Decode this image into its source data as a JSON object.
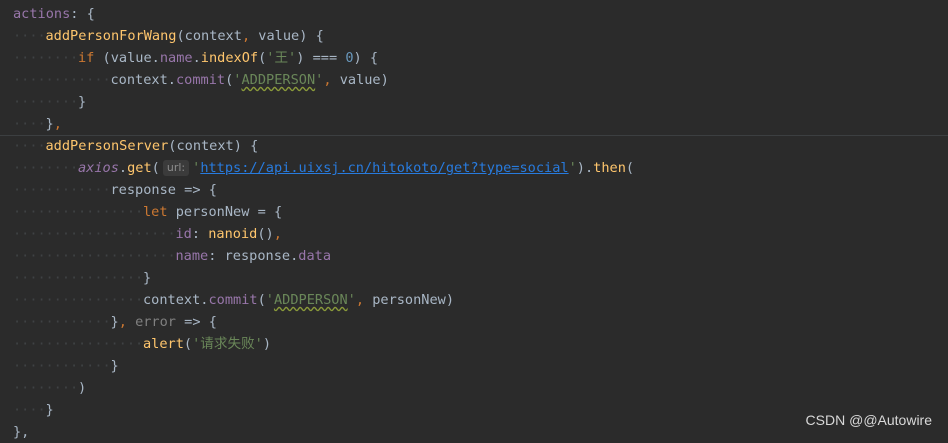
{
  "editor": {
    "lines": [
      {
        "indent": 0,
        "tokens": [
          {
            "t": "actions",
            "c": "prop"
          },
          {
            "t": ": {",
            "c": "plain"
          }
        ]
      },
      {
        "indent": 1,
        "tokens": [
          {
            "t": "addPersonForWang",
            "c": "fn"
          },
          {
            "t": "(context",
            "c": "plain"
          },
          {
            "t": ",",
            "c": "kw"
          },
          {
            "t": " value) {",
            "c": "plain"
          }
        ]
      },
      {
        "indent": 2,
        "tokens": [
          {
            "t": "if",
            "c": "kw"
          },
          {
            "t": " (value.",
            "c": "plain"
          },
          {
            "t": "name",
            "c": "prop"
          },
          {
            "t": ".",
            "c": "plain"
          },
          {
            "t": "indexOf",
            "c": "fn"
          },
          {
            "t": "(",
            "c": "plain"
          },
          {
            "t": "'王'",
            "c": "str"
          },
          {
            "t": ") === ",
            "c": "plain"
          },
          {
            "t": "0",
            "c": "num"
          },
          {
            "t": ") {",
            "c": "plain"
          }
        ]
      },
      {
        "indent": 3,
        "tokens": [
          {
            "t": "context.",
            "c": "plain"
          },
          {
            "t": "commit",
            "c": "prop"
          },
          {
            "t": "(",
            "c": "plain"
          },
          {
            "t": "'",
            "c": "str"
          },
          {
            "t": "ADDPERSON",
            "c": "str squig-str"
          },
          {
            "t": "'",
            "c": "str"
          },
          {
            "t": ",",
            "c": "kw"
          },
          {
            "t": " value)",
            "c": "plain"
          }
        ]
      },
      {
        "indent": 2,
        "tokens": [
          {
            "t": "}",
            "c": "plain"
          }
        ]
      },
      {
        "indent": 1,
        "tokens": [
          {
            "t": "}",
            "c": "plain"
          },
          {
            "t": ",",
            "c": "kw"
          }
        ]
      },
      {
        "indent": 1,
        "tokens": [
          {
            "t": "addPersonServer",
            "c": "fn"
          },
          {
            "t": "(context) {",
            "c": "plain"
          }
        ]
      },
      {
        "indent": 2,
        "tokens": [
          {
            "t": "axios",
            "c": "ital"
          },
          {
            "t": ".",
            "c": "plain"
          },
          {
            "t": "get",
            "c": "fn"
          },
          {
            "t": "(",
            "c": "plain"
          },
          {
            "t": "url:",
            "c": "hint"
          },
          {
            "t": "'",
            "c": "str"
          },
          {
            "t": "https://api.uixsj.cn/hitokoto/get?type=social",
            "c": "url"
          },
          {
            "t": "'",
            "c": "str"
          },
          {
            "t": ").",
            "c": "plain"
          },
          {
            "t": "then",
            "c": "fn"
          },
          {
            "t": "(",
            "c": "plain"
          }
        ]
      },
      {
        "indent": 3,
        "tokens": [
          {
            "t": "response => {",
            "c": "plain"
          }
        ]
      },
      {
        "indent": 4,
        "tokens": [
          {
            "t": "let",
            "c": "kw"
          },
          {
            "t": " personNew = {",
            "c": "plain"
          }
        ]
      },
      {
        "indent": 5,
        "tokens": [
          {
            "t": "id",
            "c": "prop"
          },
          {
            "t": ": ",
            "c": "plain"
          },
          {
            "t": "nanoid",
            "c": "fn"
          },
          {
            "t": "()",
            "c": "plain"
          },
          {
            "t": ",",
            "c": "kw"
          }
        ]
      },
      {
        "indent": 5,
        "tokens": [
          {
            "t": "name",
            "c": "prop"
          },
          {
            "t": ": response.",
            "c": "plain"
          },
          {
            "t": "data",
            "c": "prop"
          }
        ]
      },
      {
        "indent": 4,
        "tokens": [
          {
            "t": "}",
            "c": "plain"
          }
        ]
      },
      {
        "indent": 4,
        "tokens": [
          {
            "t": "context.",
            "c": "plain"
          },
          {
            "t": "commit",
            "c": "prop"
          },
          {
            "t": "(",
            "c": "plain"
          },
          {
            "t": "'",
            "c": "str"
          },
          {
            "t": "ADDPERSON",
            "c": "str squig-str"
          },
          {
            "t": "'",
            "c": "str"
          },
          {
            "t": ",",
            "c": "kw"
          },
          {
            "t": " personNew)",
            "c": "plain"
          }
        ]
      },
      {
        "indent": 3,
        "tokens": [
          {
            "t": "}",
            "c": "plain"
          },
          {
            "t": ",",
            "c": "kw"
          },
          {
            "t": " ",
            "c": "plain"
          },
          {
            "t": "error",
            "c": "muted"
          },
          {
            "t": " => {",
            "c": "plain"
          }
        ]
      },
      {
        "indent": 4,
        "tokens": [
          {
            "t": "alert",
            "c": "fn"
          },
          {
            "t": "(",
            "c": "plain"
          },
          {
            "t": "'请求失败'",
            "c": "str"
          },
          {
            "t": ")",
            "c": "plain"
          }
        ]
      },
      {
        "indent": 3,
        "tokens": [
          {
            "t": "}",
            "c": "plain"
          }
        ]
      },
      {
        "indent": 2,
        "tokens": [
          {
            "t": ")",
            "c": "plain"
          }
        ]
      },
      {
        "indent": 1,
        "tokens": [
          {
            "t": "}",
            "c": "plain"
          }
        ]
      },
      {
        "indent": 0,
        "tokens": [
          {
            "t": "},",
            "c": "plain"
          }
        ]
      }
    ]
  },
  "watermark": "CSDN @@Autowire"
}
